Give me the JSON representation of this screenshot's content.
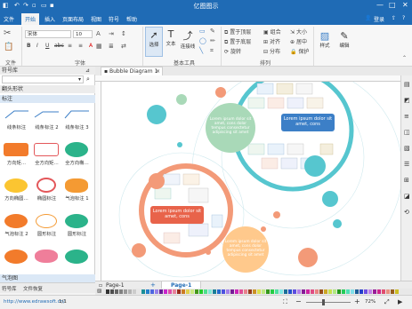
{
  "window": {
    "title": "亿图图示",
    "minimize": "—",
    "maximize": "□",
    "close": "✕"
  },
  "menu": {
    "file": "文件",
    "items": [
      "开始",
      "插入",
      "页面布局",
      "视图",
      "符号",
      "帮助"
    ],
    "login": "登录"
  },
  "ribbon": {
    "font_name": "宋体",
    "font_size": "10",
    "groups": {
      "file": "文件",
      "font": "字体",
      "basic_tools": "基本工具",
      "arrange": "排列"
    },
    "tools": {
      "select": "选择",
      "text": "文本",
      "connector": "连接线",
      "style": "样式",
      "edit": "编辑"
    },
    "arrange": {
      "bring_front": "置于顶层",
      "send_back": "置于底层",
      "group": "组合",
      "ungroup": "取消组合",
      "align": "对齐",
      "distribute": "分布",
      "size": "大小",
      "center": "居中",
      "rotate": "旋转",
      "protect": "保护"
    },
    "format": {
      "bold": "B",
      "italic": "I",
      "underline": "U",
      "strike": "abc",
      "bullets": "≡",
      "align_center": "≡",
      "font_color": "A"
    }
  },
  "library": {
    "title": "符号库",
    "search_placeholder": "",
    "section_bubbles": "翻头形状",
    "section_callouts": "标注",
    "items": [
      {
        "label": "线条标注",
        "shape": "line"
      },
      {
        "label": "线条标注 2",
        "shape": "line"
      },
      {
        "label": "线条标注 3",
        "shape": "line"
      },
      {
        "label": "方向矩…",
        "shape": "bubble-orange"
      },
      {
        "label": "全方向矩…",
        "shape": "bubble-red"
      },
      {
        "label": "全方向椭…",
        "shape": "bubble-green"
      },
      {
        "label": "方向椭圆…",
        "shape": "bubble-yellow"
      },
      {
        "label": "椭圆标注",
        "shape": "bubble-ring"
      },
      {
        "label": "气泡标注 1",
        "shape": "bubble-star"
      },
      {
        "label": "气泡标注 2",
        "shape": "cloud-orange"
      },
      {
        "label": "圆形标注",
        "shape": "cloud-outline"
      },
      {
        "label": "圆形标注",
        "shape": "cloud-green"
      },
      {
        "label": "",
        "shape": "cloud-orange2"
      },
      {
        "label": "",
        "shape": "cloud-pink"
      },
      {
        "label": "",
        "shape": "cloud-teal"
      }
    ],
    "bottom_section": "气泡图",
    "tabs": [
      "符号库",
      "文件恢复"
    ]
  },
  "document": {
    "tab_label": "Bubble Diagram 1",
    "tab_close": "×",
    "add_tab": "+"
  },
  "canvas": {
    "lorem_teal": "Lorem ipsum dolor sit amet, cons",
    "lorem_green": "Lorem ipsum dolor sit amet, cons dolor tempus consectetur adipiscing sit amet",
    "lorem_red": "Lorem ipsum dolor sit amet, cons",
    "lorem_yellow": "Lorem ipsum dolor sit amet, cons dolor tempus consectetur adipiscing sit amet"
  },
  "pages": {
    "current": "Page-1",
    "tab": "Page-1",
    "add": "+"
  },
  "status": {
    "url": "http://www.edrawsoft.cn/",
    "page_count": "1/1",
    "zoom": "72%",
    "zoom_minus": "−",
    "zoom_plus": "+"
  },
  "colors": {
    "accent": "#1f6bb5",
    "teal": "#56c6cf",
    "green": "#a9d9b8",
    "orange": "#f39a78",
    "red": "#e8634a",
    "yellow": "#ffc98c",
    "blue_rect": "#3c7fc7"
  }
}
